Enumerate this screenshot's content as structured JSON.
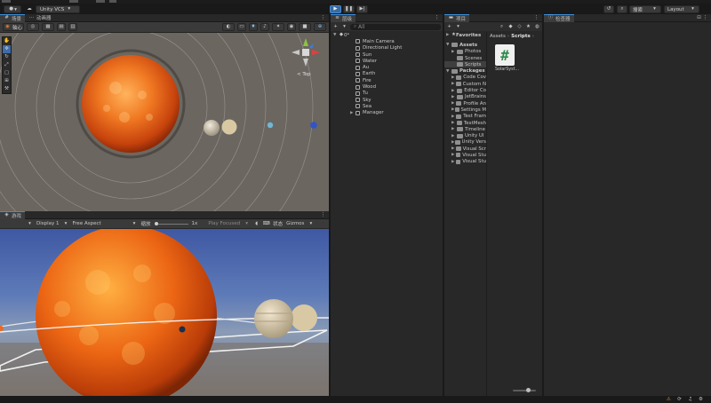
{
  "menubar": {
    "items": [
      "",
      "",
      "",
      ""
    ]
  },
  "toolbar": {
    "account_label": "Unity VCS",
    "search_label": "搜索",
    "layout_label": "Layout"
  },
  "scene_view": {
    "tab_scene": "场景",
    "tab_animator": "动画器",
    "pivot_label": "轴心",
    "gizmo_top_label": "< Top"
  },
  "game_view": {
    "tab_game": "游戏",
    "display": "Display 1",
    "aspect": "Free Aspect",
    "scale_label": "缩放",
    "scale_value": "1x",
    "play_focused": "Play Focused",
    "stats": "状态",
    "gizmos": "Gizmos"
  },
  "hierarchy": {
    "tab": "层级",
    "root": "0*",
    "items": [
      "Main Camera",
      "Directional Light",
      "Sun",
      "Water",
      "Au",
      "Earth",
      "Fire",
      "Wood",
      "Tu",
      "Sky",
      "Sea",
      "Manager"
    ]
  },
  "project": {
    "tab": "项目",
    "favorites_label": "Favorites",
    "assets_label": "Assets",
    "assets_children": [
      "Photos",
      "Scenes",
      "Scripts"
    ],
    "packages_label": "Packages",
    "packages_children": [
      "Code Cov",
      "Custom N",
      "Editor Co",
      "JetBrains",
      "Profile An",
      "Settings M",
      "Test Fram",
      "TextMesh",
      "Timeline",
      "Unity UI",
      "Unity Vers",
      "Visual Scr",
      "Visual Stu",
      "Visual Stu"
    ],
    "breadcrumb_assets": "Assets",
    "breadcrumb_scripts": "Scripts",
    "file_name": "SolarSyst...",
    "file_icon": "#"
  },
  "inspector": {
    "tab": "检查器"
  },
  "colors": {
    "accent": "#3b8fdc",
    "panel": "#282828",
    "background": "#191919",
    "scene_bg": "#6b6660",
    "sun_orange": "#e3611a",
    "script_green": "#2d8b4b"
  }
}
